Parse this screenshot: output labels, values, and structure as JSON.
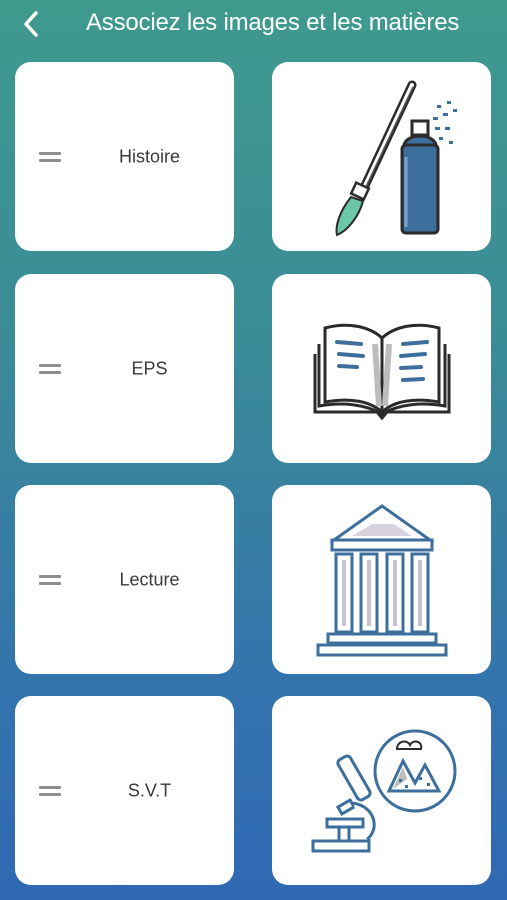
{
  "header": {
    "title": "Associez les images et les matières",
    "back_icon": "chevron-left-icon"
  },
  "colors": {
    "background_top": "#3f9a8e",
    "background_bottom": "#2f68b3",
    "card": "#ffffff",
    "illustration_blue": "#3d6f9c",
    "illustration_green": "#6cc7a6"
  },
  "words": [
    {
      "label": "Histoire"
    },
    {
      "label": "EPS"
    },
    {
      "label": "Lecture"
    },
    {
      "label": "S.V.T"
    }
  ],
  "images": [
    {
      "icon": "paintbrush-spray-icon"
    },
    {
      "icon": "open-book-icon"
    },
    {
      "icon": "greek-temple-icon"
    },
    {
      "icon": "microscope-mountains-icon"
    }
  ]
}
